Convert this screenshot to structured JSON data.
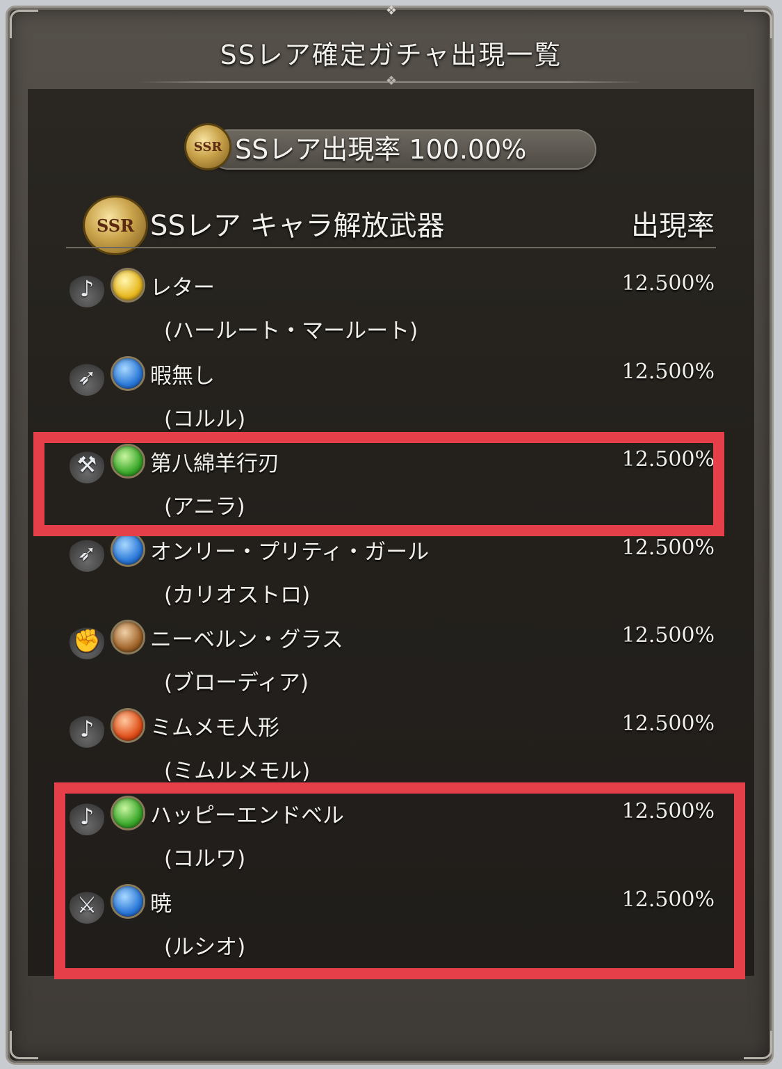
{
  "header": {
    "title": "SSレア確定ガチャ出現一覧"
  },
  "rate_summary": {
    "badge_label": "SSR",
    "text": "SSレア出現率 100.00%"
  },
  "section": {
    "badge_label": "SSR",
    "title": "SSレア キャラ解放武器",
    "rate_header": "出現率"
  },
  "items": [
    {
      "weapon": "レター",
      "character": "(ハールート・マールート)",
      "rate": "12.500%",
      "element": "light-element-icon",
      "weapon_type": "harp-icon"
    },
    {
      "weapon": "暇無し",
      "character": "(コルル)",
      "rate": "12.500%",
      "element": "water-element-icon",
      "weapon_type": "spear-icon"
    },
    {
      "weapon": "第八綿羊行刃",
      "character": "(アニラ)",
      "rate": "12.500%",
      "element": "wind-element-icon",
      "weapon_type": "axe-icon"
    },
    {
      "weapon": "オンリー・プリティ・ガール",
      "character": "(カリオストロ)",
      "rate": "12.500%",
      "element": "water-element-icon",
      "weapon_type": "spear-icon"
    },
    {
      "weapon": "ニーベルン・グラス",
      "character": "(ブローディア)",
      "rate": "12.500%",
      "element": "earth-element-icon",
      "weapon_type": "fist-icon"
    },
    {
      "weapon": "ミムメモ人形",
      "character": "(ミムルメモル)",
      "rate": "12.500%",
      "element": "fire-element-icon",
      "weapon_type": "harp-icon"
    },
    {
      "weapon": "ハッピーエンドベル",
      "character": "(コルワ)",
      "rate": "12.500%",
      "element": "wind-element-icon",
      "weapon_type": "harp-icon"
    },
    {
      "weapon": "暁",
      "character": "(ルシオ)",
      "rate": "12.500%",
      "element": "water-element-icon",
      "weapon_type": "sword-icon"
    }
  ],
  "colors": {
    "highlight": "#e5404a",
    "panel_bg": "#24211d",
    "text": "#f1efea"
  }
}
